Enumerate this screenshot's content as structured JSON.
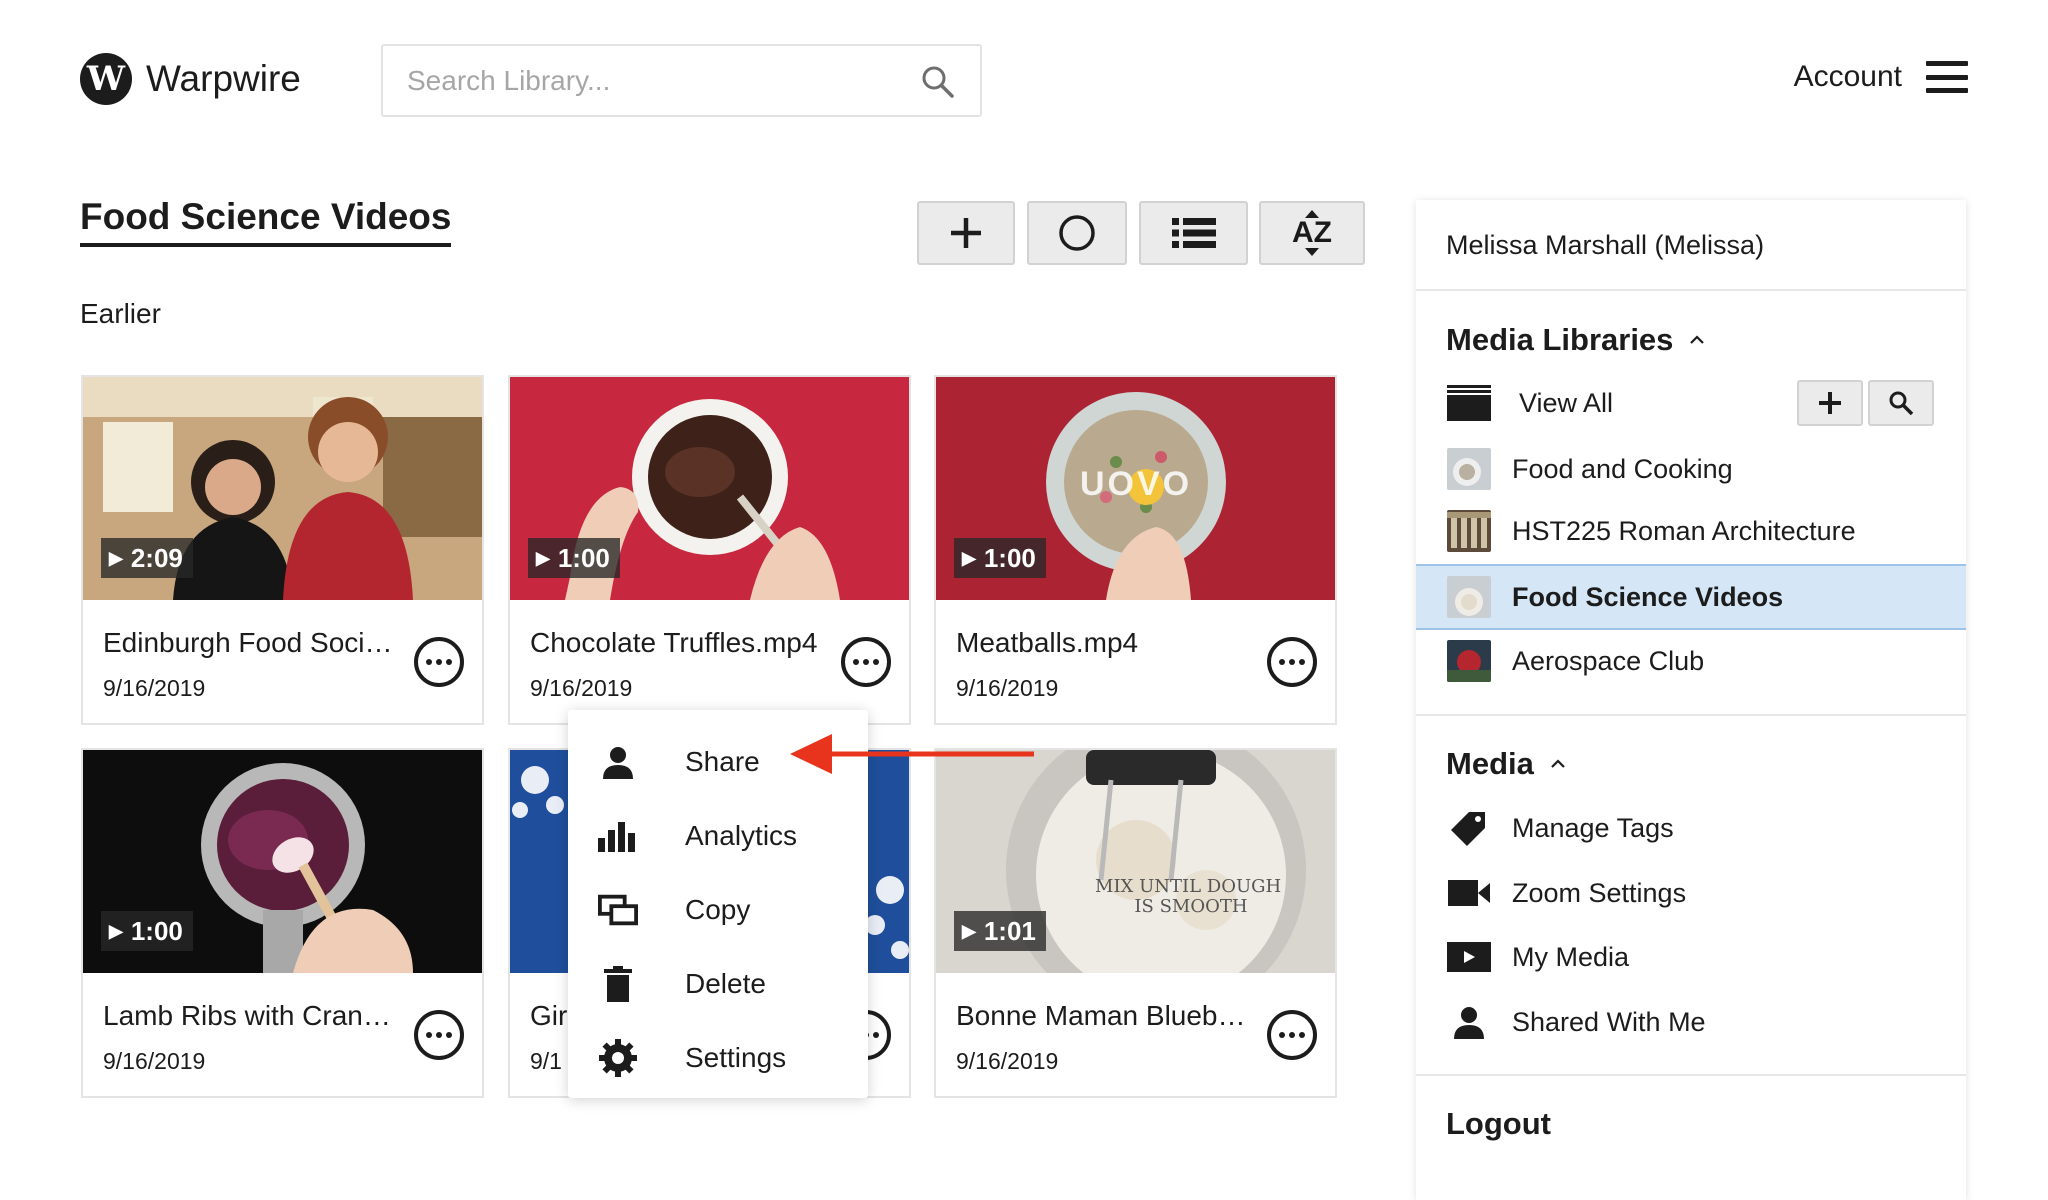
{
  "header": {
    "logo_text": "Warpwire",
    "logo_letter": "W",
    "search_placeholder": "Search Library...",
    "account_label": "Account"
  },
  "page": {
    "title": "Food Science Videos",
    "section_label": "Earlier"
  },
  "toolbar": {
    "sort_label": "AZ"
  },
  "cards": [
    {
      "title": "Edinburgh Food Soci…",
      "date": "9/16/2019",
      "duration": "2:09"
    },
    {
      "title": "Chocolate Truffles.mp4",
      "date": "9/16/2019",
      "duration": "1:00"
    },
    {
      "title": "Meatballs.mp4",
      "date": "9/16/2019",
      "duration": "1:00",
      "overlay_text": "UOVO"
    },
    {
      "title": "Lamb Ribs with Cran…",
      "date": "9/16/2019",
      "duration": "1:00"
    },
    {
      "title": "Gir",
      "date": "9/1",
      "duration": ""
    },
    {
      "title": "Bonne Maman Blueb…",
      "date": "9/16/2019",
      "duration": "1:01",
      "overlay_text": "MIX UNTIL DOUGH IS SMOOTH"
    }
  ],
  "context_menu": {
    "items": [
      {
        "label": "Share",
        "icon": "person-icon"
      },
      {
        "label": "Analytics",
        "icon": "bar-chart-icon"
      },
      {
        "label": "Copy",
        "icon": "copy-icon"
      },
      {
        "label": "Delete",
        "icon": "trash-icon"
      },
      {
        "label": "Settings",
        "icon": "gear-icon"
      }
    ]
  },
  "sidebar": {
    "user": "Melissa Marshall (Melissa)",
    "libraries_heading": "Media Libraries",
    "libraries": [
      {
        "label": "View All"
      },
      {
        "label": "Food and Cooking"
      },
      {
        "label": "HST225 Roman Architecture"
      },
      {
        "label": "Food Science Videos",
        "active": true
      },
      {
        "label": "Aerospace Club"
      }
    ],
    "media_heading": "Media",
    "media_items": [
      {
        "label": "Manage Tags",
        "icon": "tag-icon"
      },
      {
        "label": "Zoom Settings",
        "icon": "video-camera-icon"
      },
      {
        "label": "My Media",
        "icon": "play-box-icon"
      },
      {
        "label": "Shared With Me",
        "icon": "person-icon"
      }
    ],
    "logout_label": "Logout"
  },
  "colors": {
    "active_item_bg": "#d5e6f7",
    "annotation_arrow": "#e8341c",
    "text": "#1c1c1c"
  }
}
